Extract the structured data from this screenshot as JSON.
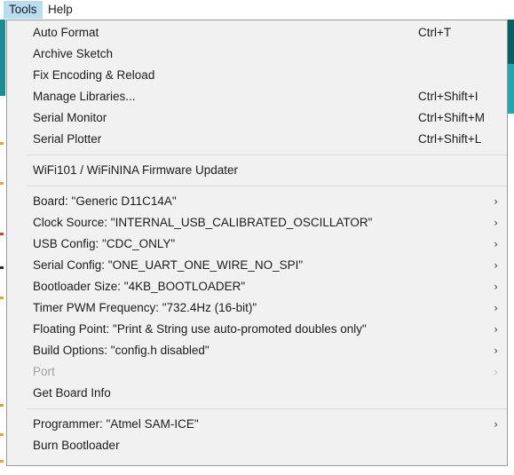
{
  "menubar": {
    "items": [
      {
        "label": "Tools",
        "active": true
      },
      {
        "label": "Help",
        "active": false
      }
    ]
  },
  "colors": {
    "menu_background": "#f1f1f1",
    "menu_border": "#9a9a9a",
    "menubar_highlight": "#b8dcf2",
    "text": "#1c1c1c",
    "disabled_text": "#a0a0a0",
    "separator": "#dcdcdc",
    "accent_teal_dark": "#056065",
    "accent_teal_light": "#1ea9ae"
  },
  "tools_menu": {
    "sections": [
      {
        "items": [
          {
            "label": "Auto Format",
            "shortcut": "Ctrl+T",
            "submenu": false,
            "disabled": false
          },
          {
            "label": "Archive Sketch",
            "shortcut": "",
            "submenu": false,
            "disabled": false
          },
          {
            "label": "Fix Encoding & Reload",
            "shortcut": "",
            "submenu": false,
            "disabled": false
          },
          {
            "label": "Manage Libraries...",
            "shortcut": "Ctrl+Shift+I",
            "submenu": false,
            "disabled": false
          },
          {
            "label": "Serial Monitor",
            "shortcut": "Ctrl+Shift+M",
            "submenu": false,
            "disabled": false
          },
          {
            "label": "Serial Plotter",
            "shortcut": "Ctrl+Shift+L",
            "submenu": false,
            "disabled": false
          }
        ]
      },
      {
        "items": [
          {
            "label": "WiFi101 / WiFiNINA Firmware Updater",
            "shortcut": "",
            "submenu": false,
            "disabled": false
          }
        ]
      },
      {
        "items": [
          {
            "label": "Board: \"Generic D11C14A\"",
            "shortcut": "",
            "submenu": true,
            "disabled": false
          },
          {
            "label": "Clock Source: \"INTERNAL_USB_CALIBRATED_OSCILLATOR\"",
            "shortcut": "",
            "submenu": true,
            "disabled": false
          },
          {
            "label": "USB Config: \"CDC_ONLY\"",
            "shortcut": "",
            "submenu": true,
            "disabled": false
          },
          {
            "label": "Serial Config: \"ONE_UART_ONE_WIRE_NO_SPI\"",
            "shortcut": "",
            "submenu": true,
            "disabled": false
          },
          {
            "label": "Bootloader Size: \"4KB_BOOTLOADER\"",
            "shortcut": "",
            "submenu": true,
            "disabled": false
          },
          {
            "label": "Timer PWM Frequency: \"732.4Hz (16-bit)\"",
            "shortcut": "",
            "submenu": true,
            "disabled": false
          },
          {
            "label": "Floating Point: \"Print & String use auto-promoted doubles only\"",
            "shortcut": "",
            "submenu": true,
            "disabled": false
          },
          {
            "label": "Build Options: \"config.h disabled\"",
            "shortcut": "",
            "submenu": true,
            "disabled": false
          },
          {
            "label": "Port",
            "shortcut": "",
            "submenu": true,
            "disabled": true
          },
          {
            "label": "Get Board Info",
            "shortcut": "",
            "submenu": false,
            "disabled": false
          }
        ]
      },
      {
        "items": [
          {
            "label": "Programmer: \"Atmel SAM-ICE\"",
            "shortcut": "",
            "submenu": true,
            "disabled": false
          },
          {
            "label": "Burn Bootloader",
            "shortcut": "",
            "submenu": false,
            "disabled": false
          }
        ]
      }
    ]
  },
  "icons": {
    "submenu_chevron": "chevron-right-icon"
  }
}
